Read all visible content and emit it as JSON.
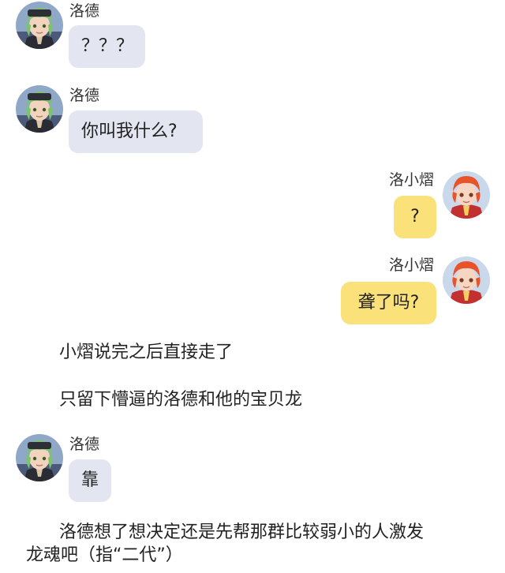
{
  "colors": {
    "left_bubble": "#e3e6f0",
    "right_bubble": "#fbe17a",
    "page_background": "#ffffff"
  },
  "messages": [
    {
      "side": "left",
      "sender": "洛德",
      "avatar": "green-hair-boy-avatar",
      "text": "？？？"
    },
    {
      "side": "left",
      "sender": "洛德",
      "avatar": "green-hair-boy-avatar",
      "text": "你叫我什么?"
    },
    {
      "side": "right",
      "sender": "洛小熠",
      "avatar": "red-hair-boy-avatar",
      "text": "?"
    },
    {
      "side": "right",
      "sender": "洛小熠",
      "avatar": "red-hair-boy-avatar",
      "text": "聋了吗?"
    },
    {
      "side": "left",
      "sender": "洛德",
      "avatar": "green-hair-boy-avatar",
      "text": "靠"
    }
  ],
  "narration": {
    "line1": "小熠说完之后直接走了",
    "line2": "只留下懵逼的洛德和他的宝贝龙",
    "line3a": "洛德想了想决定还是先帮那群比较弱小的人激发",
    "line3b": "龙魂吧（指“二代”）"
  }
}
